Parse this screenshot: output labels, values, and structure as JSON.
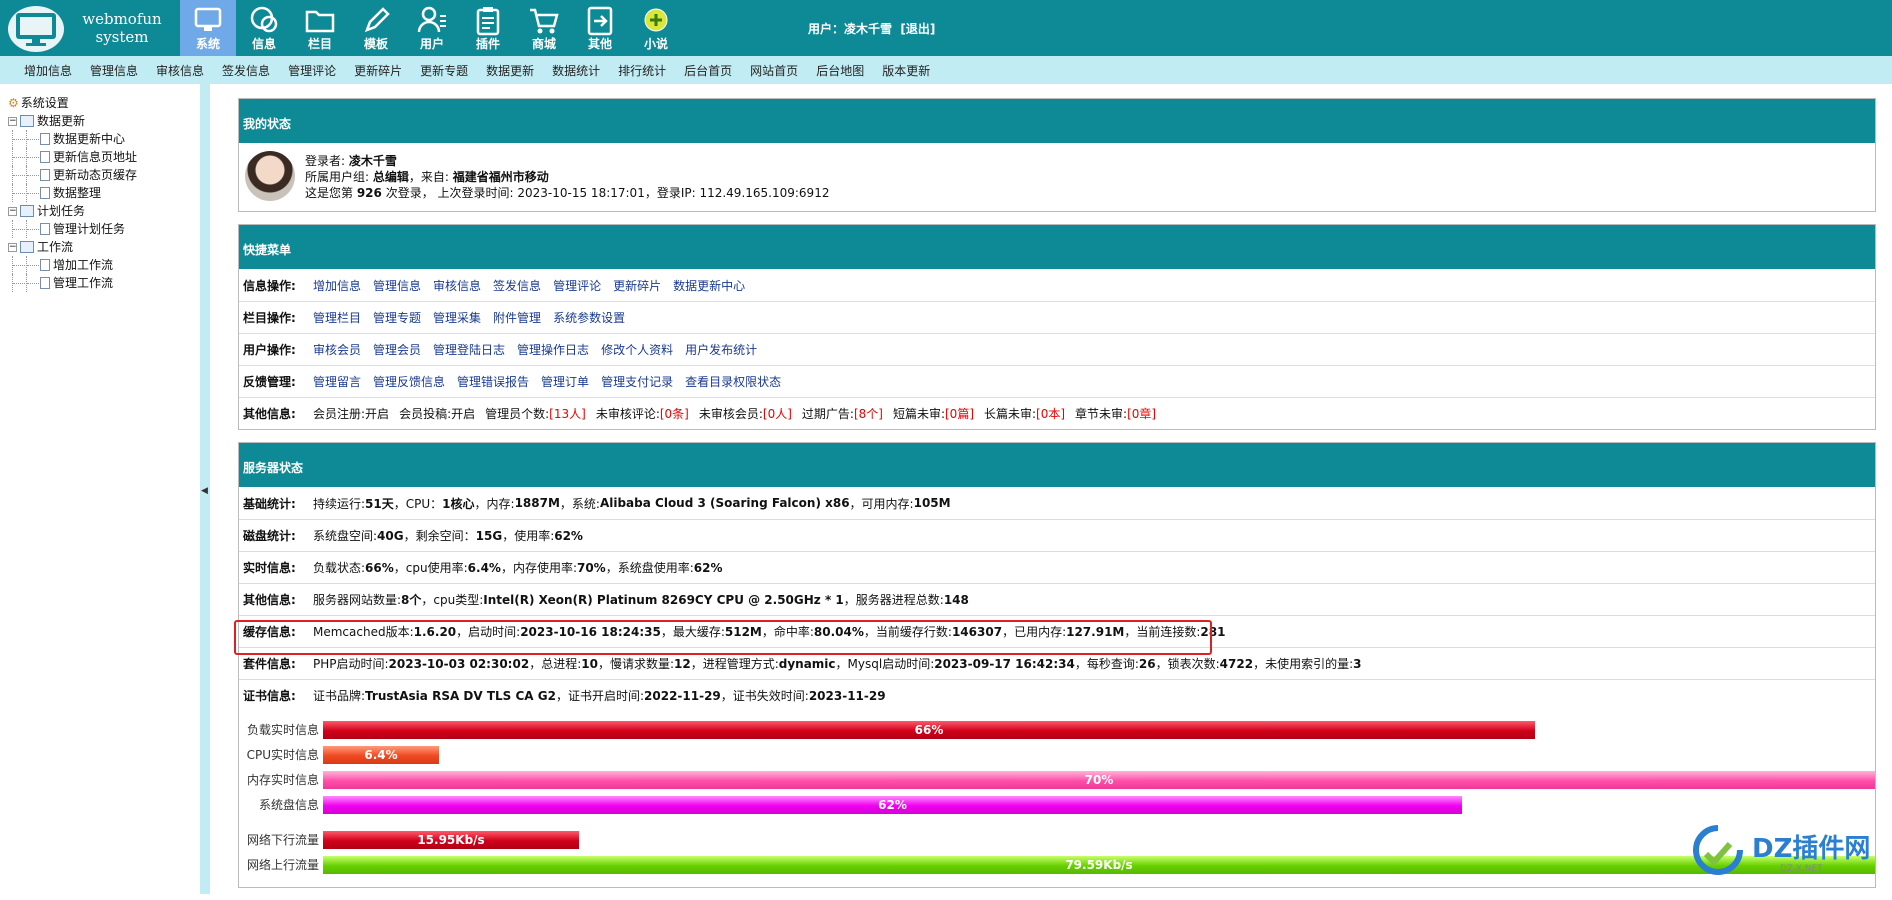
{
  "logo": {
    "line1": "webmofun",
    "line2": "system"
  },
  "nav": [
    {
      "label": "系统",
      "icon": "monitor-icon",
      "active": true
    },
    {
      "label": "信息",
      "icon": "chat-icon"
    },
    {
      "label": "栏目",
      "icon": "folder-icon"
    },
    {
      "label": "模板",
      "icon": "pencil-icon"
    },
    {
      "label": "用户",
      "icon": "user-icon"
    },
    {
      "label": "插件",
      "icon": "clipboard-icon"
    },
    {
      "label": "商城",
      "icon": "cart-icon"
    },
    {
      "label": "其他",
      "icon": "exit-icon"
    },
    {
      "label": "小说",
      "icon": "plus-circle-icon"
    }
  ],
  "user": {
    "prefix": "用户：",
    "name": "凌木千雪",
    "logout": "[退出]"
  },
  "subnav": [
    "增加信息",
    "管理信息",
    "审核信息",
    "签发信息",
    "管理评论",
    "更新碎片",
    "更新专题",
    "数据更新",
    "数据统计",
    "排行统计",
    "后台首页",
    "网站首页",
    "后台地图",
    "版本更新"
  ],
  "tree": {
    "root": "系统设置",
    "groups": [
      {
        "label": "数据更新",
        "items": [
          "数据更新中心",
          "更新信息页地址",
          "更新动态页缓存",
          "数据整理"
        ]
      },
      {
        "label": "计划任务",
        "items": [
          "管理计划任务"
        ]
      },
      {
        "label": "工作流",
        "items": [
          "增加工作流",
          "管理工作流"
        ]
      }
    ]
  },
  "status": {
    "title": "我的状态",
    "line1_label": "登录者: ",
    "line1_value": "凌木千雪",
    "line2_label": "所属用户组: ",
    "line2_value": "总编辑",
    "line2_from_label": "，来自: ",
    "line2_from": "福建省福州市移动",
    "line3_a": "这是您第 ",
    "line3_count": "926",
    "line3_b": " 次登录，  上次登录时间:   2023-10-15 18:17:01，登录IP:   112.49.165.109:6912"
  },
  "quick": {
    "title": "快捷菜单",
    "rows": [
      {
        "label": "信息操作:",
        "links": [
          "增加信息",
          "管理信息",
          "审核信息",
          "签发信息",
          "管理评论",
          "更新碎片",
          "数据更新中心"
        ]
      },
      {
        "label": "栏目操作:",
        "links": [
          "管理栏目",
          "管理专题",
          "管理采集",
          "附件管理",
          "系统参数设置"
        ]
      },
      {
        "label": "用户操作:",
        "links": [
          "审核会员",
          "管理会员",
          "管理登陆日志",
          "管理操作日志",
          "修改个人资料",
          "用户发布统计"
        ]
      },
      {
        "label": "反馈管理:",
        "links": [
          "管理留言",
          "管理反馈信息",
          "管理错误报告",
          "管理订单",
          "管理支付记录",
          "查看目录权限状态"
        ]
      }
    ],
    "other": {
      "label": "其他信息:",
      "items": [
        {
          "k": "会员注册:",
          "v": "开启",
          "red": false
        },
        {
          "k": "会员投稿:",
          "v": "开启",
          "red": false
        },
        {
          "k": "管理员个数:",
          "v": "[13人]",
          "red": true
        },
        {
          "k": "未审核评论:",
          "v": "[0条]",
          "red": true
        },
        {
          "k": "未审核会员:",
          "v": "[0人]",
          "red": true
        },
        {
          "k": "过期广告:",
          "v": "[8个]",
          "red": true
        },
        {
          "k": "短篇未审:",
          "v": "[0篇]",
          "red": true
        },
        {
          "k": "长篇未审:",
          "v": "[0本]",
          "red": true
        },
        {
          "k": "章节未审:",
          "v": "[0章]",
          "red": true
        }
      ]
    }
  },
  "server": {
    "title": "服务器状态",
    "rows": [
      {
        "label": "基础统计:",
        "parts": [
          [
            "持续运行:",
            "51天"
          ],
          [
            "，CPU：",
            "1核心"
          ],
          [
            "，内存: ",
            "1887M"
          ],
          [
            "，系统: ",
            "Alibaba Cloud 3 (Soaring Falcon) x86"
          ],
          [
            "，可用内存: ",
            "105M"
          ]
        ]
      },
      {
        "label": "磁盘统计:",
        "parts": [
          [
            "系统盘空间:",
            "40G"
          ],
          [
            "，剩余空间：",
            "15G"
          ],
          [
            "，使用率: ",
            "62%"
          ]
        ]
      },
      {
        "label": "实时信息:",
        "parts": [
          [
            "负载状态:",
            "66%"
          ],
          [
            "，cpu使用率:",
            "6.4%"
          ],
          [
            "，内存使用率:",
            "70%"
          ],
          [
            "，系统盘使用率: ",
            "62%"
          ]
        ]
      },
      {
        "label": "其他信息:",
        "parts": [
          [
            "服务器网站数量:",
            "8个"
          ],
          [
            "，cpu类型:",
            "Intel(R) Xeon(R) Platinum 8269CY CPU @ 2.50GHz * 1"
          ],
          [
            "，服务器进程总数:",
            "148"
          ]
        ]
      },
      {
        "label": "缓存信息:",
        "parts": [
          [
            "Memcached版本:",
            "1.6.20"
          ],
          [
            "，启动时间:",
            "2023-10-16 18:24:35"
          ],
          [
            "，最大缓存:",
            "512M"
          ],
          [
            "，命中率:",
            "80.04%"
          ],
          [
            "，当前缓存行数: ",
            "146307"
          ],
          [
            "，已用内存: ",
            "127.91M"
          ],
          [
            "，当前连接数: ",
            "281"
          ]
        ]
      },
      {
        "label": "套件信息:",
        "parts": [
          [
            "PHP启动时间:",
            "2023-10-03 02:30:02"
          ],
          [
            "，总进程:",
            "10"
          ],
          [
            "，慢请求数量: ",
            "12"
          ],
          [
            "，进程管理方式: ",
            "dynamic"
          ],
          [
            "，Mysql启动时间:",
            "2023-09-17 16:42:34"
          ],
          [
            "，每秒查询:",
            "26"
          ],
          [
            "，锁表次数: ",
            "4722"
          ],
          [
            "，未使用索引的量: ",
            "3"
          ]
        ]
      },
      {
        "label": "证书信息:",
        "parts": [
          [
            "证书品牌:",
            "TrustAsia RSA DV TLS CA G2"
          ],
          [
            "，证书开启时间: ",
            "2022-11-29"
          ],
          [
            "，证书失效时间: ",
            "2023-11-29"
          ]
        ]
      }
    ]
  },
  "bars": [
    {
      "label": "负载实时信息",
      "text": "66%",
      "fraction": 0.781,
      "color": "fill-red"
    },
    {
      "label": "CPU实时信息",
      "text": "6.4%",
      "fraction": 0.075,
      "color": "fill-orange"
    },
    {
      "label": "内存实时信息",
      "text": "70%",
      "fraction": 1.0,
      "color": "fill-pink"
    },
    {
      "label": "系统盘信息",
      "text": "62%",
      "fraction": 0.734,
      "color": "fill-magenta"
    },
    {
      "label": "网络下行流量",
      "text": "15.95Kb/s",
      "fraction": 0.165,
      "color": "fill-red",
      "gap": true
    },
    {
      "label": "网络上行流量",
      "text": "79.59Kb/s",
      "fraction": 1.0,
      "color": "fill-green"
    }
  ],
  "watermark": {
    "text": "DZ插件网",
    "sub": "DZ-X.NET"
  }
}
